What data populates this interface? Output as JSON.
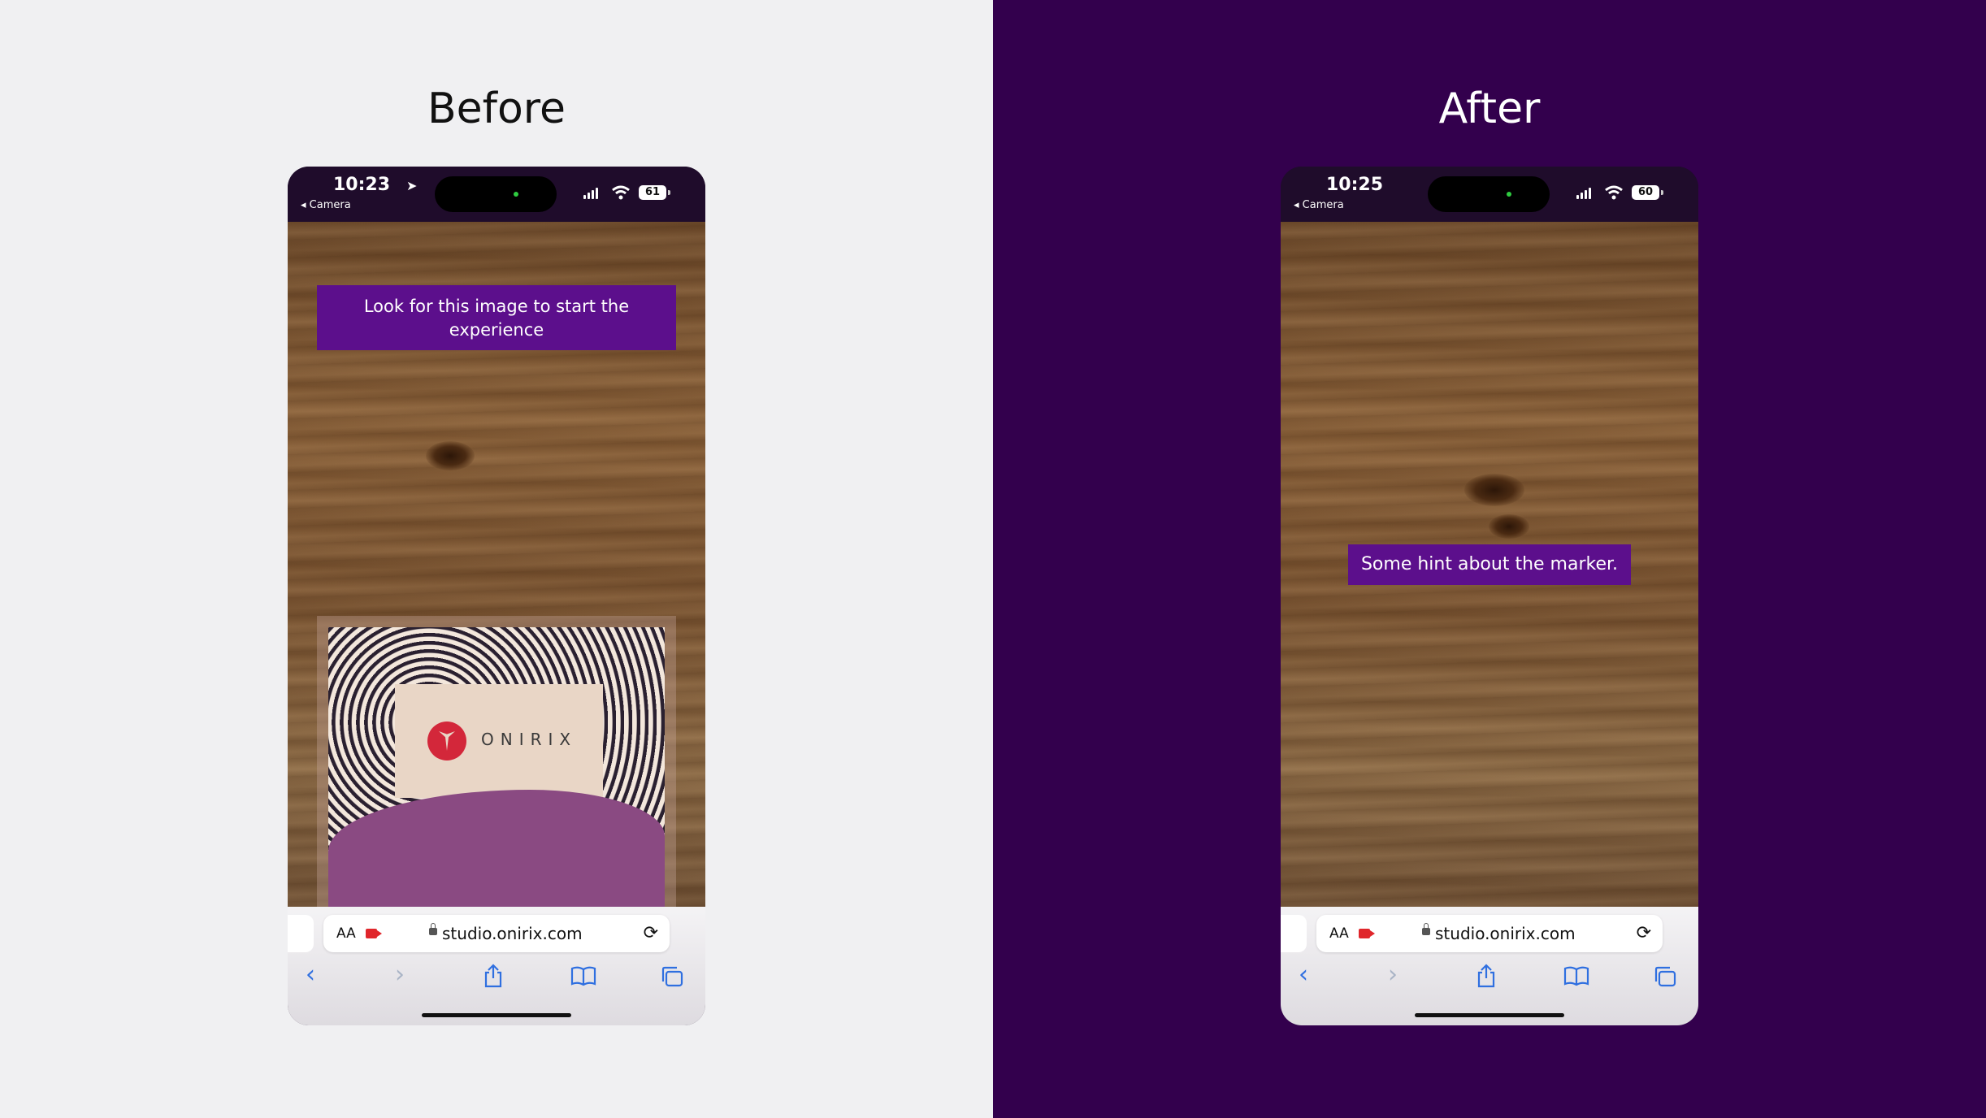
{
  "panels": [
    {
      "title": "Before",
      "status": {
        "time": "10:23",
        "back": "◂ Camera",
        "battery": "61"
      },
      "overlay_text": "Look for this image to start the experience",
      "marker_logo_text": "ONIRIX",
      "url": "studio.onirix.com",
      "aa_label": "AA"
    },
    {
      "title": "After",
      "status": {
        "time": "10:25",
        "back": "◂ Camera",
        "battery": "60"
      },
      "overlay_text": "Some hint about the marker.",
      "url": "studio.onirix.com",
      "aa_label": "AA"
    }
  ],
  "icons": {
    "location": "location-arrow-icon",
    "reload": "reload-icon",
    "back": "back-arrow-icon",
    "forward": "forward-arrow-icon",
    "share": "share-icon",
    "bookmarks": "bookmarks-icon",
    "tabs": "tabs-icon"
  },
  "colors": {
    "left_background": "#f0f0f2",
    "right_background": "#33004d",
    "hint_box": "#5c0f8c",
    "toolbar_accent": "#2f6fe0"
  }
}
